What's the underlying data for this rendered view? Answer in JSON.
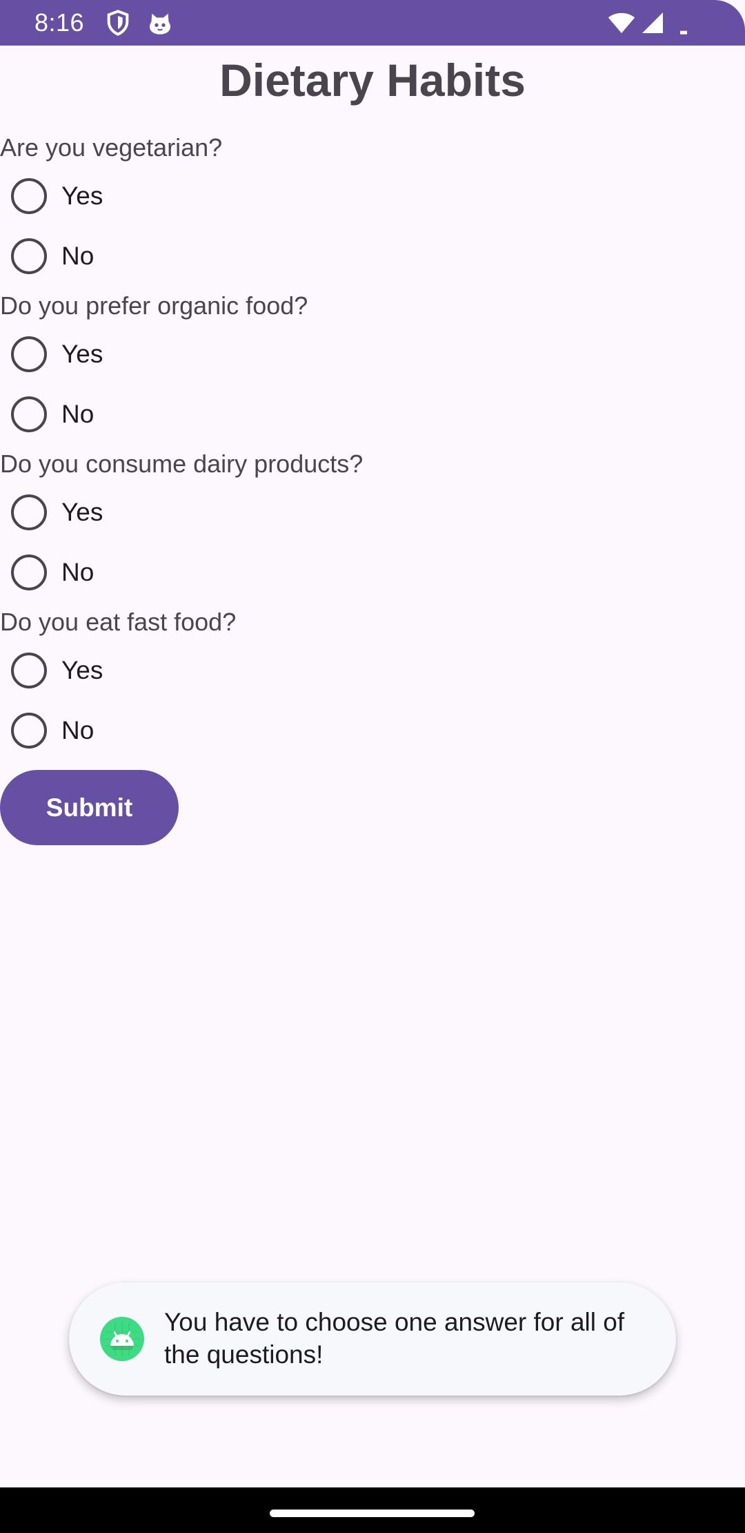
{
  "status_bar": {
    "time": "8:16",
    "icons": [
      "shield-icon",
      "cat-face-icon",
      "wifi-icon",
      "cellular-signal-icon",
      "battery-icon"
    ],
    "color": "#6750a4"
  },
  "page": {
    "title": "Dietary Habits"
  },
  "questions": [
    {
      "text": "Are you vegetarian?",
      "options": [
        "Yes",
        "No"
      ],
      "selected": null
    },
    {
      "text": "Do you prefer organic food?",
      "options": [
        "Yes",
        "No"
      ],
      "selected": null
    },
    {
      "text": "Do you consume dairy products?",
      "options": [
        "Yes",
        "No"
      ],
      "selected": null
    },
    {
      "text": "Do you eat fast food?",
      "options": [
        "Yes",
        "No"
      ],
      "selected": null
    }
  ],
  "submit": {
    "label": "Submit",
    "color": "#6750a4"
  },
  "toast": {
    "message": "You have to choose one answer for all of the questions!",
    "icon": "android-app-icon"
  },
  "navigation_bar": {
    "handle": "home-handle"
  }
}
